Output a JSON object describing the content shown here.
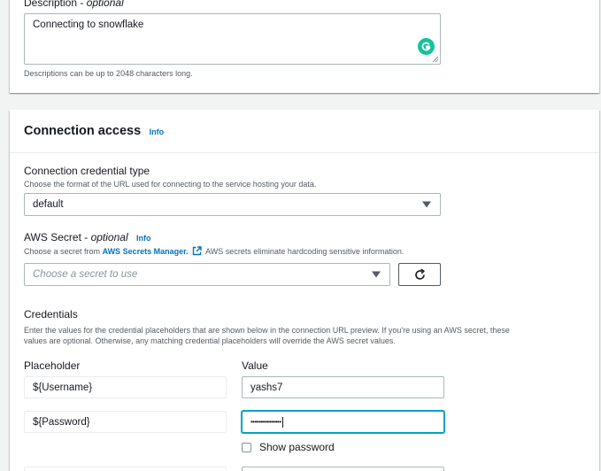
{
  "description": {
    "label": "Description",
    "optional": "optional",
    "value": "Connecting to snowflake",
    "hint": "Descriptions can be up to 2048 characters long."
  },
  "connection_access": {
    "title": "Connection access",
    "info": "Info",
    "credential_type": {
      "label": "Connection credential type",
      "hint": "Choose the format of the URL used for connecting to the service hosting your data.",
      "value": "default"
    },
    "aws_secret": {
      "label": "AWS Secret",
      "optional": "optional",
      "info": "Info",
      "hint_prefix": "Choose a secret from",
      "hint_link": "AWS Secrets Manager.",
      "hint_suffix": "AWS secrets eliminate hardcoding sensitive information.",
      "placeholder": "Choose a secret to use"
    },
    "credentials": {
      "label": "Credentials",
      "hint_line1": "Enter the values for the credential placeholders that are shown below in the connection URL preview. If you're using an AWS secret, these",
      "hint_line2": "values are optional. Otherwise, any matching credential placeholders will override the AWS secret values.",
      "placeholder_header": "Placeholder",
      "value_header": "Value",
      "rows": [
        {
          "placeholder": "${Username}",
          "value": "yashs7"
        },
        {
          "placeholder": "${Password}",
          "value": "•••••••••••••••"
        }
      ],
      "show_password": "Show password"
    }
  },
  "colors": {
    "link": "#0073bb",
    "focus": "#00a1c9",
    "grammarly": "#15c39a",
    "background": "#f2f3f3"
  }
}
